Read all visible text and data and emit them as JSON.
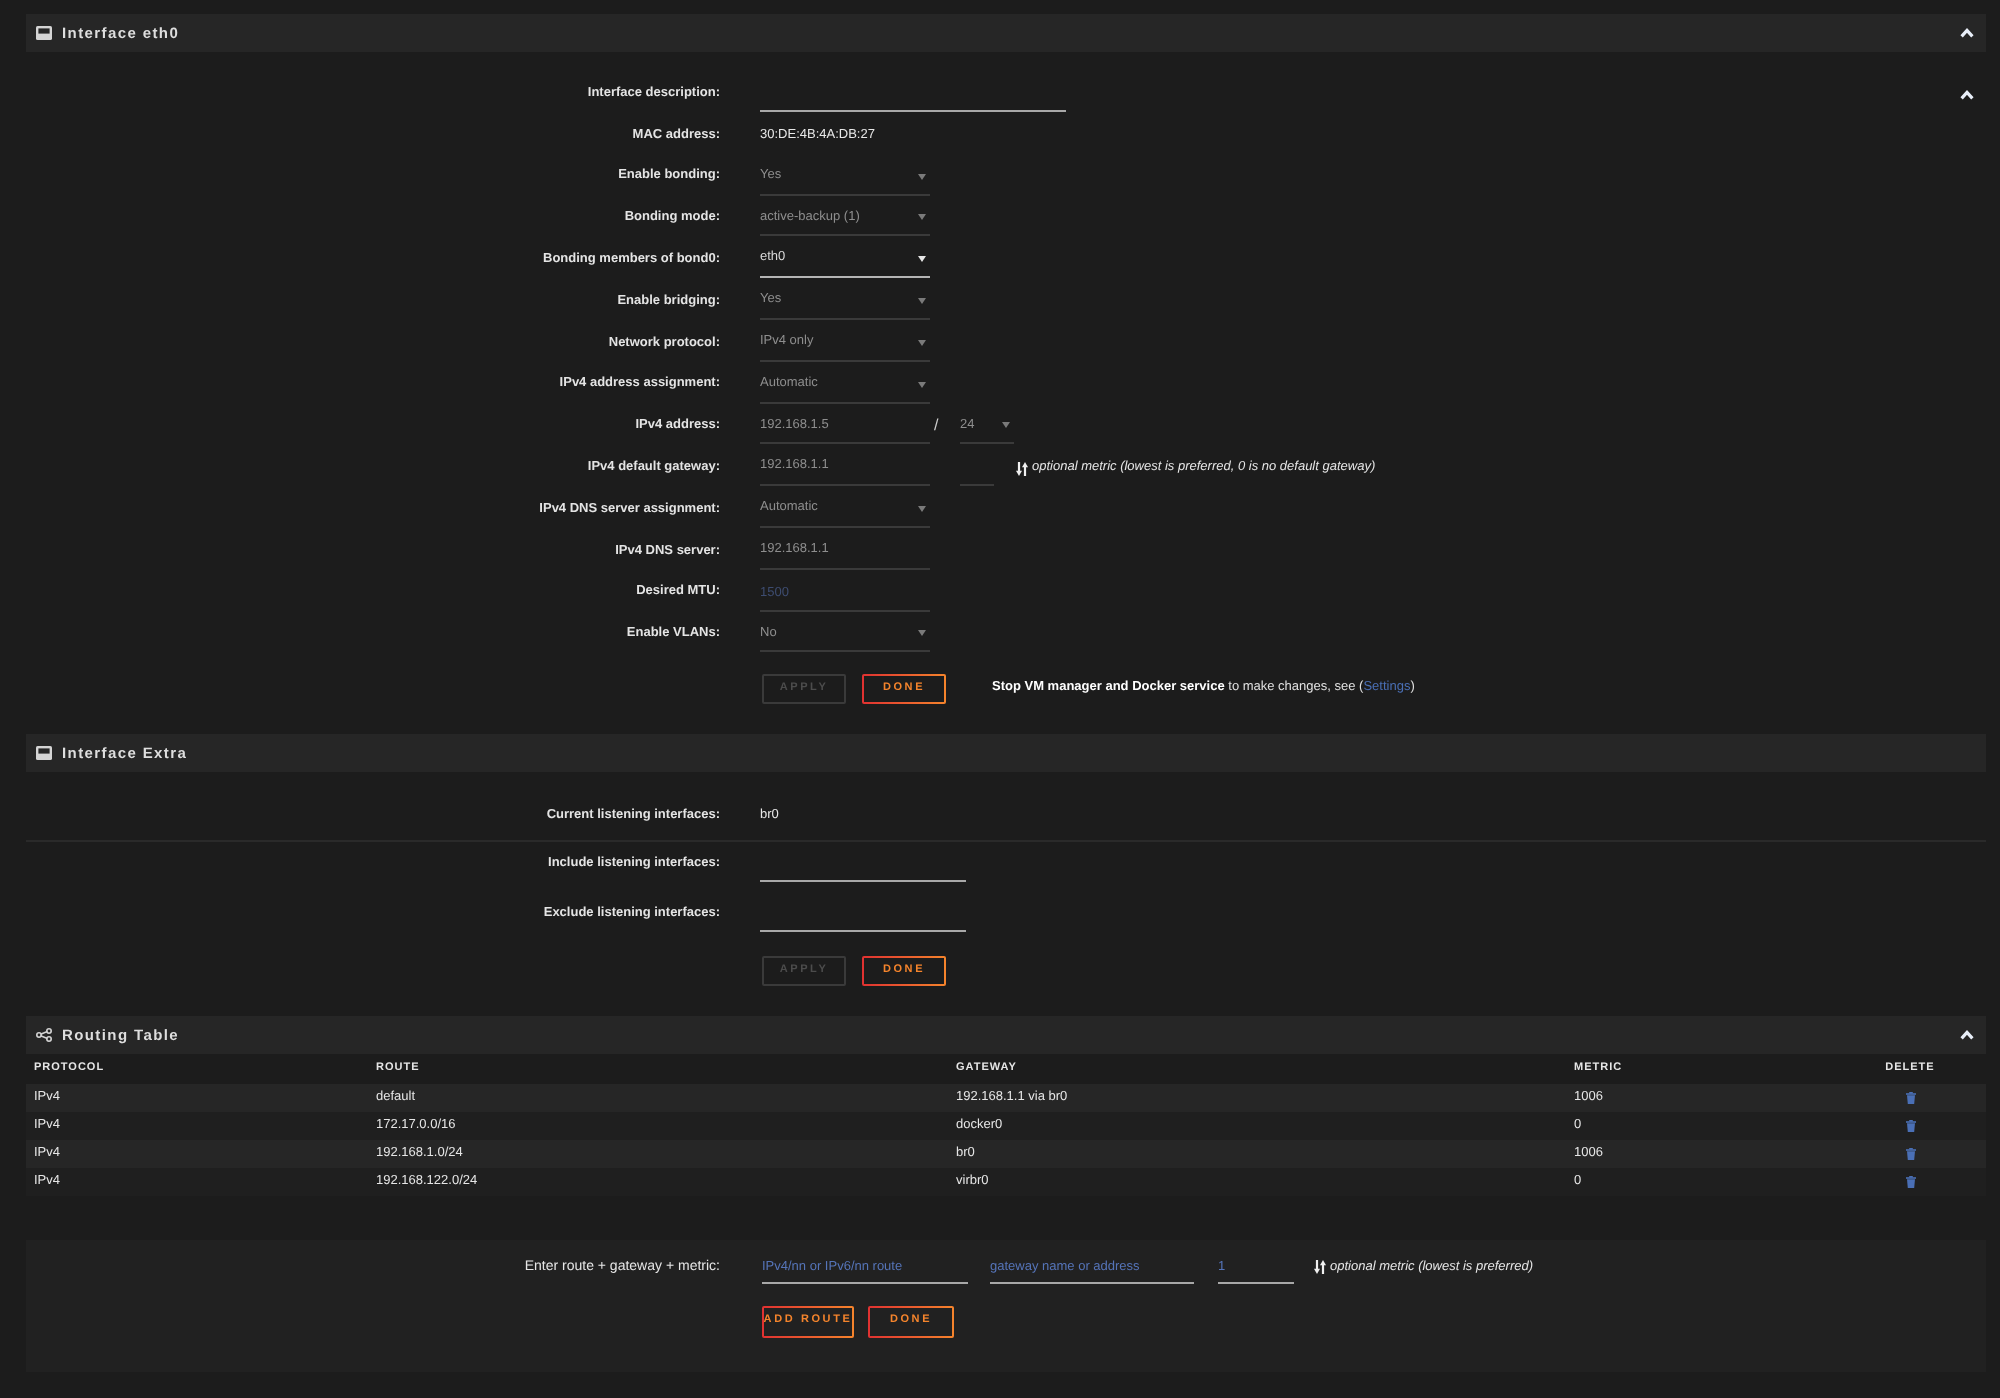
{
  "interface_eth0": {
    "title": "Interface eth0",
    "expanded": true,
    "form_expanded": true,
    "fields": [
      {
        "kind": "longtext",
        "label": "Interface description:",
        "disabled": false
      },
      {
        "kind": "static",
        "label": "MAC address:",
        "value": "30:DE:4B:4A:DB:27"
      },
      {
        "kind": "select",
        "label": "Enable bonding:",
        "value": "Yes",
        "disabled": true
      },
      {
        "kind": "select",
        "label": "Bonding mode:",
        "value": "active-backup (1)",
        "disabled": true
      },
      {
        "kind": "select",
        "label": "Bonding members of bond0:",
        "value": "eth0",
        "disabled": false
      },
      {
        "kind": "select",
        "label": "Enable bridging:",
        "value": "Yes",
        "disabled": true
      },
      {
        "kind": "select",
        "label": "Network protocol:",
        "value": "IPv4 only",
        "disabled": true
      },
      {
        "kind": "select",
        "label": "IPv4 address assignment:",
        "value": "Automatic",
        "disabled": true
      },
      {
        "kind": "cidr",
        "label": "IPv4 address:",
        "value": "192.168.1.5",
        "separator": "/",
        "mask": "24",
        "disabled": true
      },
      {
        "kind": "gateway",
        "label": "IPv4 default gateway:",
        "value": "192.168.1.1",
        "hint": "optional metric (lowest is preferred, 0 is no default gateway)",
        "disabled": true
      },
      {
        "kind": "select",
        "label": "IPv4 DNS server assignment:",
        "value": "Automatic",
        "disabled": true
      },
      {
        "kind": "input",
        "label": "IPv4 DNS server:",
        "value": "192.168.1.1",
        "disabled": true
      },
      {
        "kind": "input",
        "label": "Desired MTU:",
        "placeholder": "1500",
        "disabled": true
      },
      {
        "kind": "select",
        "label": "Enable VLANs:",
        "value": "No",
        "disabled": true
      }
    ],
    "buttons": [
      {
        "label": "APPLY",
        "disabled": true
      },
      {
        "label": "DONE",
        "disabled": false
      }
    ],
    "notice": {
      "text": "**Stop VM manager and Docker service** to make changes, see (",
      "link": "Settings",
      "text_end": ")"
    }
  },
  "interface_extra": {
    "title": "Interface Extra",
    "fields": [
      {
        "kind": "static",
        "label": "Current listening interfaces:",
        "value": "br0"
      },
      {
        "kind": "input",
        "label": "Include listening interfaces:",
        "disabled": false
      },
      {
        "kind": "input",
        "label": "Exclude listening interfaces:",
        "disabled": false
      }
    ],
    "buttons": [
      {
        "label": "APPLY",
        "disabled": true
      },
      {
        "label": "DONE",
        "disabled": false
      }
    ]
  },
  "routing_table": {
    "title": "Routing Table",
    "expanded": true,
    "columns": [
      "PROTOCOL",
      "ROUTE",
      "GATEWAY",
      "METRIC",
      "DELETE"
    ],
    "rows": [
      {
        "protocol": "IPv4",
        "route": "default",
        "gateway": "192.168.1.1 via br0",
        "metric": "1006"
      },
      {
        "protocol": "IPv4",
        "route": "172.17.0.0/16",
        "gateway": "docker0",
        "metric": "0"
      },
      {
        "protocol": "IPv4",
        "route": "192.168.1.0/24",
        "gateway": "br0",
        "metric": "1006"
      },
      {
        "protocol": "IPv4",
        "route": "192.168.122.0/24",
        "gateway": "virbr0",
        "metric": "0"
      }
    ]
  },
  "add_route": {
    "label": "Enter route + gateway + metric:",
    "fields": [
      {
        "placeholder": "IPv4/nn or IPv6/nn route"
      },
      {
        "placeholder": "gateway name or address"
      },
      {
        "placeholder": "1"
      }
    ],
    "hint": "optional metric (lowest is preferred)",
    "buttons": [
      {
        "label": "ADD ROUTE",
        "disabled": false
      },
      {
        "label": "DONE",
        "disabled": false
      }
    ]
  }
}
